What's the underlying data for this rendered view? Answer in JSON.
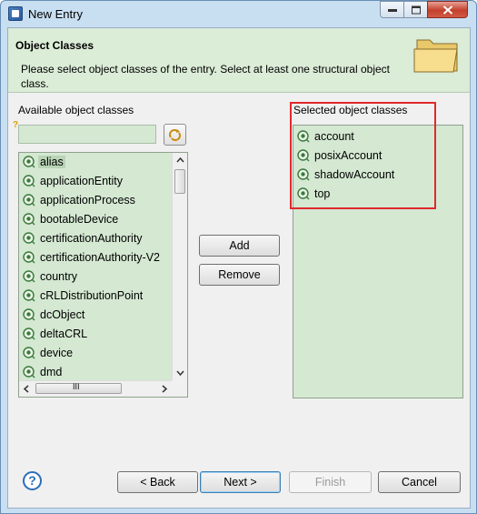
{
  "window": {
    "title": "New Entry",
    "colors": {
      "header_bg": "#dbecd7",
      "list_bg": "#d4e8d2",
      "highlight": "#e0292b"
    }
  },
  "header": {
    "title": "Object Classes",
    "description": "Please select object classes of the entry. Select at least one structural object class.",
    "icon": "folder-icon"
  },
  "available": {
    "label": "Available object classes",
    "filter_value": "",
    "filter_button_icon": "refresh-filter-icon",
    "items": [
      {
        "label": "alias"
      },
      {
        "label": "applicationEntity"
      },
      {
        "label": "applicationProcess"
      },
      {
        "label": "bootableDevice"
      },
      {
        "label": "certificationAuthority"
      },
      {
        "label": "certificationAuthority-V2"
      },
      {
        "label": "country"
      },
      {
        "label": "cRLDistributionPoint"
      },
      {
        "label": "dcObject"
      },
      {
        "label": "deltaCRL"
      },
      {
        "label": "device"
      },
      {
        "label": "dmd"
      }
    ],
    "selected_index": 0,
    "hscroll_grip": "III"
  },
  "actions": {
    "add_label": "Add",
    "remove_label": "Remove"
  },
  "selected": {
    "label": "Selected object classes",
    "items": [
      {
        "label": "account"
      },
      {
        "label": "posixAccount"
      },
      {
        "label": "shadowAccount"
      },
      {
        "label": "top"
      }
    ]
  },
  "footer": {
    "help_icon": "help-icon",
    "back_label": "< Back",
    "next_label": "Next >",
    "finish_label": "Finish",
    "cancel_label": "Cancel"
  }
}
